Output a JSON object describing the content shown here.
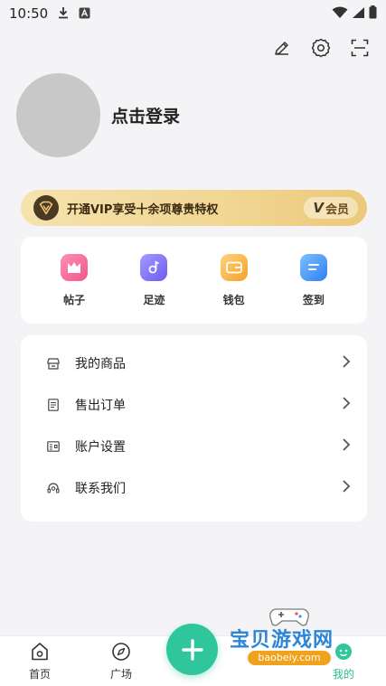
{
  "status_bar": {
    "time": "10:50"
  },
  "profile": {
    "login_text": "点击登录"
  },
  "vip": {
    "text": "开通VIP享受十余项尊贵特权",
    "badge_v": "V",
    "badge_label": "会员"
  },
  "quick": [
    {
      "label": "帖子",
      "color": "#f56c9a"
    },
    {
      "label": "足迹",
      "color": "#7a6cf6"
    },
    {
      "label": "钱包",
      "color": "#f5a623"
    },
    {
      "label": "签到",
      "color": "#3d8ff5"
    }
  ],
  "menu": [
    {
      "label": "我的商品",
      "icon": "store-icon"
    },
    {
      "label": "售出订单",
      "icon": "order-icon"
    },
    {
      "label": "账户设置",
      "icon": "id-card-icon"
    },
    {
      "label": "联系我们",
      "icon": "headset-icon"
    }
  ],
  "tabs": {
    "home": "首页",
    "plaza": "广场",
    "mine": "我的"
  },
  "watermark": {
    "title": "宝贝游戏网",
    "url": "baobeiy.com"
  },
  "colors": {
    "accent": "#2ec69a",
    "vip_gold": "#f1d693"
  }
}
